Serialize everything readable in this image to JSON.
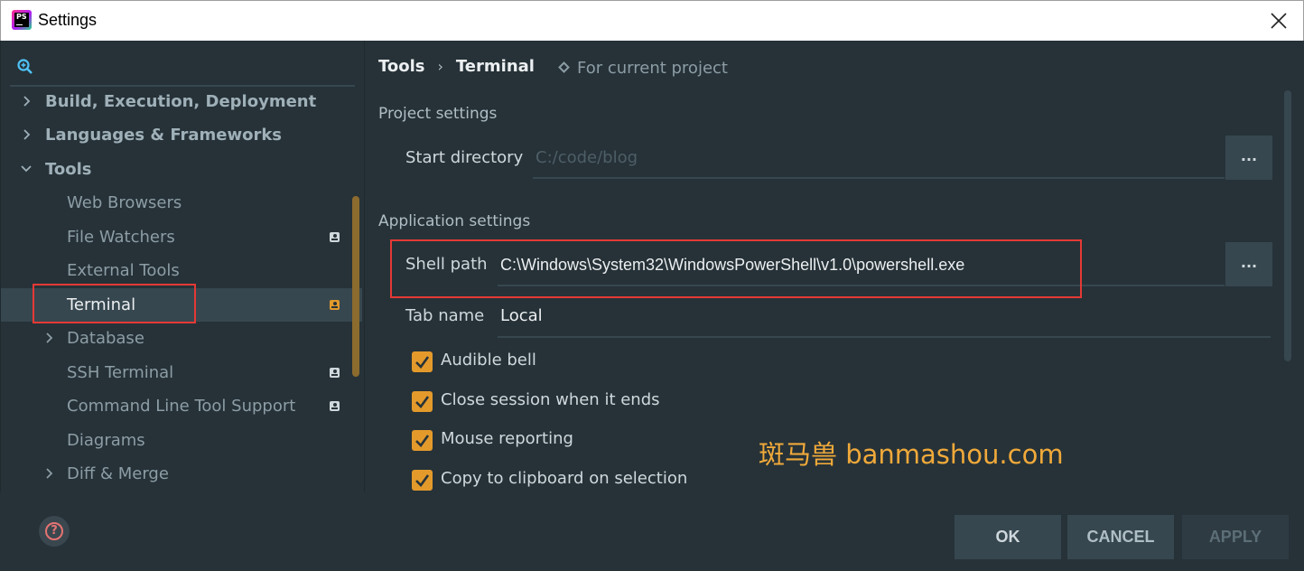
{
  "window": {
    "title": "Settings",
    "app_icon_text": "PS"
  },
  "search": {
    "placeholder": ""
  },
  "tree": {
    "items": [
      {
        "label": "Build, Execution, Deployment"
      },
      {
        "label": "Languages & Frameworks"
      },
      {
        "label": "Tools"
      },
      {
        "label": "Web Browsers"
      },
      {
        "label": "File Watchers"
      },
      {
        "label": "External Tools"
      },
      {
        "label": "Terminal"
      },
      {
        "label": "Database"
      },
      {
        "label": "SSH Terminal"
      },
      {
        "label": "Command Line Tool Support"
      },
      {
        "label": "Diagrams"
      },
      {
        "label": "Diff & Merge"
      }
    ]
  },
  "breadcrumb": {
    "parent": "Tools",
    "separator": "›",
    "current": "Terminal",
    "scope": "For current project"
  },
  "project_settings": {
    "title": "Project settings",
    "start_directory_label": "Start directory",
    "start_directory_placeholder": "C:/code/blog",
    "browse_label": "..."
  },
  "application_settings": {
    "title": "Application settings",
    "shell_path_label": "Shell path",
    "shell_path_value": "C:\\Windows\\System32\\WindowsPowerShell\\v1.0\\powershell.exe",
    "browse_label": "...",
    "tab_name_label": "Tab name",
    "tab_name_value": "Local"
  },
  "checkboxes": [
    {
      "label": "Audible bell",
      "checked": true
    },
    {
      "label": "Close session when it ends",
      "checked": true
    },
    {
      "label": "Mouse reporting",
      "checked": true
    },
    {
      "label": "Copy to clipboard on selection",
      "checked": true
    }
  ],
  "watermark": "斑马兽 banmashou.com",
  "buttons": {
    "ok": "OK",
    "cancel": "CANCEL",
    "apply": "APPLY"
  },
  "help_label": "?",
  "colors": {
    "accent": "#E39A2B",
    "highlight_box": "#E53935",
    "background": "#263238"
  }
}
